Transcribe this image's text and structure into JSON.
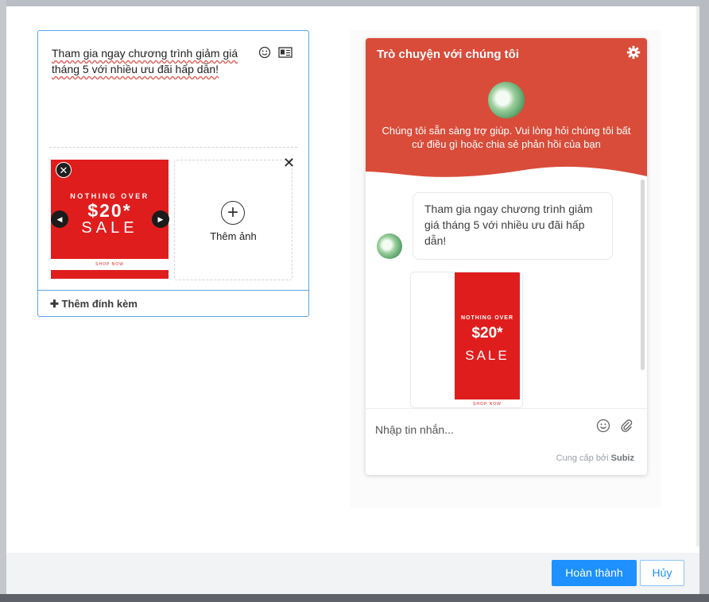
{
  "editor": {
    "text": "Tham gia ngay chương trình giảm giá tháng 5 với nhiều ưu đãi hấp dẫn!",
    "tool_icons": [
      "emoji-icon",
      "contact-card-icon"
    ],
    "thumbnail": {
      "line1": "NOTHING OVER",
      "line2": "$20*",
      "line3": "SALE",
      "line4": "SHOP NOW"
    },
    "add_image_label": "Thêm ảnh",
    "add_attachment_label": "Thêm đính kèm"
  },
  "chat_widget": {
    "title": "Trò chuyện với chúng tôi",
    "subtitle": "Chúng tôi sẵn sàng trợ giúp. Vui lòng hỏi chúng tôi bất cứ điều gì hoặc chia sẻ phản hồi của bạn",
    "header_color": "#d94c3a",
    "message_text": "Tham gia ngay chương trình giảm giá tháng 5 với nhiều ưu đãi hấp dẫn!",
    "image_card": {
      "line1": "NOTHING OVER",
      "line2": "$20*",
      "line3": "SALE",
      "line4": "SHOP NOW"
    },
    "input_placeholder": "Nhập tin nhắn...",
    "powered_prefix": "Cung cấp bởi",
    "powered_brand": "Subiz"
  },
  "footer": {
    "done_label": "Hoàn thành",
    "cancel_label": "Hủy"
  },
  "colors": {
    "accent": "#1e90ff",
    "sale_red": "#e01d1d"
  }
}
